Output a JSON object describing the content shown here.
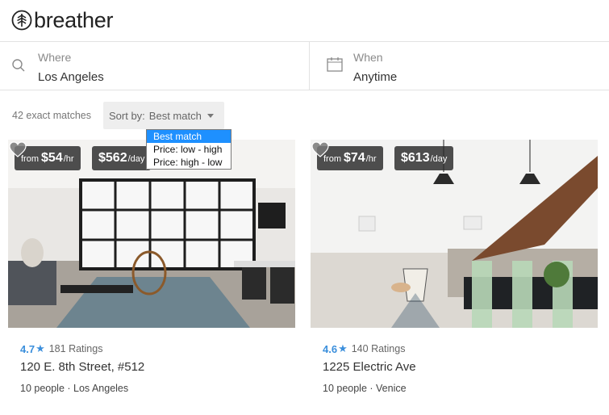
{
  "brand": {
    "name": "breather"
  },
  "search": {
    "where_label": "Where",
    "where_value": "Los Angeles",
    "when_label": "When",
    "when_value": "Anytime"
  },
  "results": {
    "count_text": "42 exact matches",
    "sort_label": "Sort by:",
    "sort_value": "Best match",
    "sort_options": [
      "Best match",
      "Price: low - high",
      "Price: high - low"
    ]
  },
  "listings": [
    {
      "price_prefix": "from",
      "hourly": "$54",
      "hourly_unit": "/hr",
      "daily": "$562",
      "daily_unit": "/day",
      "rating": "4.7",
      "star": "★",
      "ratings_count": "181 Ratings",
      "address": "120 E. 8th Street, #512",
      "meta": "10 people · Los Angeles"
    },
    {
      "price_prefix": "from",
      "hourly": "$74",
      "hourly_unit": "/hr",
      "daily": "$613",
      "daily_unit": "/day",
      "rating": "4.6",
      "star": "★",
      "ratings_count": "140 Ratings",
      "address": "1225 Electric Ave",
      "meta": "10 people · Venice"
    }
  ],
  "colors": {
    "accent": "#3b8fdc",
    "pill_bg": "#2a2a2a",
    "selected": "#1e90ff"
  }
}
